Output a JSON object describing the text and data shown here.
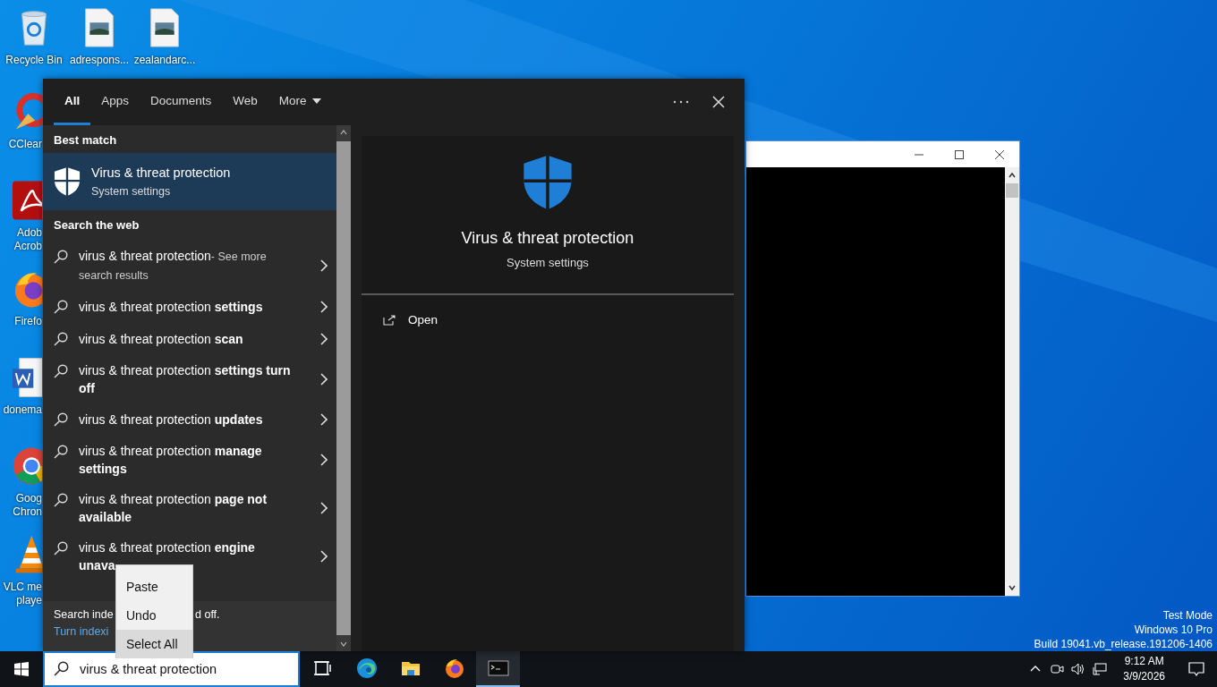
{
  "desktop": {
    "top_icons": [
      {
        "kind": "recycle",
        "lines": [
          "Recycle Bin"
        ]
      },
      {
        "kind": "image",
        "lines": [
          "adrespons..."
        ]
      },
      {
        "kind": "image",
        "lines": [
          "zealandarc..."
        ]
      }
    ],
    "left_icons": [
      {
        "kind": "ccleaner",
        "lines": [
          "CClear"
        ]
      },
      {
        "kind": "acrobat",
        "lines": [
          "Adob",
          "Acrob"
        ]
      },
      {
        "kind": "firefox",
        "lines": [
          "Firefo"
        ]
      },
      {
        "kind": "word",
        "lines": [
          "donema"
        ]
      },
      {
        "kind": "chrome",
        "lines": [
          "Goog",
          "Chron"
        ]
      },
      {
        "kind": "vlc",
        "lines": [
          "VLC me",
          "playe"
        ]
      }
    ],
    "system_info": [
      "Test Mode",
      "Windows 10 Pro",
      "Build 19041.vb_release.191206-1406"
    ]
  },
  "search": {
    "tabs": [
      {
        "label": "All",
        "selected": true,
        "dropdown": false
      },
      {
        "label": "Apps",
        "selected": false,
        "dropdown": false
      },
      {
        "label": "Documents",
        "selected": false,
        "dropdown": false
      },
      {
        "label": "Web",
        "selected": false,
        "dropdown": false
      },
      {
        "label": "More",
        "selected": false,
        "dropdown": true
      }
    ],
    "best_match": {
      "heading": "Best match",
      "title": "Virus & threat protection",
      "subtitle": "System settings",
      "selected": true
    },
    "web": {
      "heading": "Search the web",
      "results": [
        {
          "text": "virus & threat protection",
          "hint": "- See more search results"
        },
        {
          "text": "virus & threat protection **settings**"
        },
        {
          "text": "virus & threat protection **scan**"
        },
        {
          "text": "virus & threat protection **settings turn off**"
        },
        {
          "text": "virus & threat protection **updates**"
        },
        {
          "text": "virus & threat protection **manage settings**"
        },
        {
          "text": "virus & threat protection **page not available**"
        },
        {
          "text": "virus & threat protection **engine unava**"
        }
      ]
    },
    "footer": {
      "text_start": "Search inde",
      "text_end": "d off.",
      "link": "Turn indexi"
    },
    "preview": {
      "title": "Virus & threat protection",
      "subtitle": "System settings",
      "actions": [
        {
          "label": "Open"
        }
      ]
    }
  },
  "context_menu": [
    {
      "label": "Paste",
      "selected": false
    },
    {
      "label": "Undo",
      "selected": false
    },
    {
      "label": "Select All",
      "selected": true
    }
  ],
  "taskbar": {
    "search_value": "virus & threat protection",
    "apps": [
      {
        "kind": "taskview",
        "active": false
      },
      {
        "kind": "edge",
        "active": false
      },
      {
        "kind": "explorer",
        "active": false
      },
      {
        "kind": "firefox",
        "active": false
      },
      {
        "kind": "console",
        "active": true
      }
    ],
    "clock": {
      "time": "9:12 AM",
      "date": "3/9/2026"
    }
  }
}
